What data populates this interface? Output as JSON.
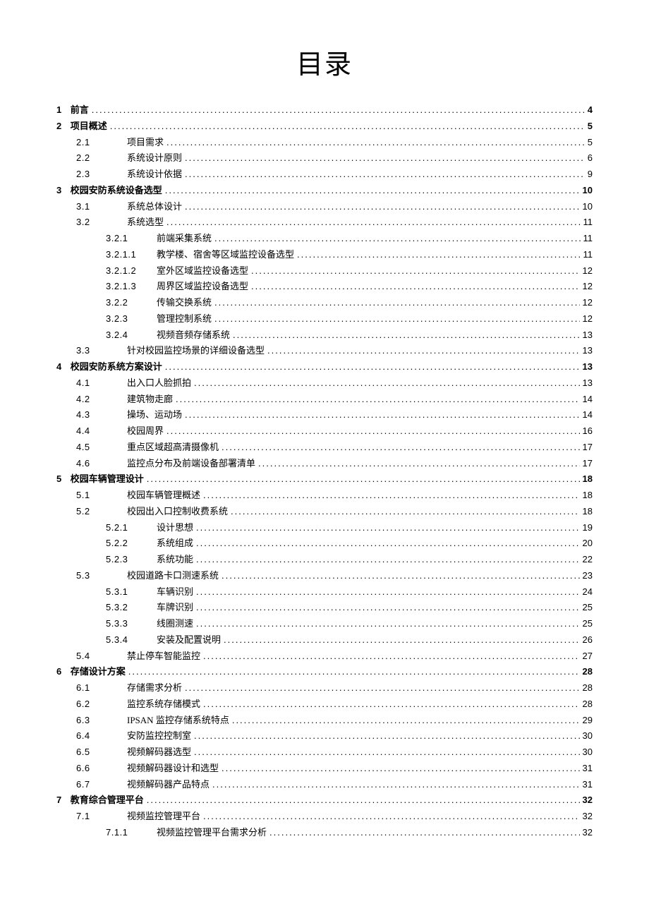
{
  "title": "目录",
  "entries": [
    {
      "level": 1,
      "bold": true,
      "num": "1",
      "label": "前言",
      "page": "4"
    },
    {
      "level": 1,
      "bold": true,
      "num": "2",
      "label": "项目概述",
      "page": "5"
    },
    {
      "level": 2,
      "num": "2.1",
      "label": "项目需求",
      "page": "5"
    },
    {
      "level": 2,
      "num": "2.2",
      "label": "系统设计原则",
      "page": "6"
    },
    {
      "level": 2,
      "num": "2.3",
      "label": "系统设计依据",
      "page": "9"
    },
    {
      "level": 1,
      "bold": true,
      "num": "3",
      "label": "校园安防系统设备选型",
      "page": "10"
    },
    {
      "level": 2,
      "num": "3.1",
      "label": "系统总体设计",
      "page": "10"
    },
    {
      "level": 2,
      "num": "3.2",
      "label": "系统选型",
      "page": "11"
    },
    {
      "level": 3,
      "num": "3.2.1",
      "label": "前端采集系统",
      "page": "11"
    },
    {
      "level": 4,
      "num": "3.2.1.1",
      "label": "教学楼、宿舍等区域监控设备选型",
      "page": "11"
    },
    {
      "level": 4,
      "num": "3.2.1.2",
      "label": "室外区域监控设备选型",
      "page": "12"
    },
    {
      "level": 4,
      "num": "3.2.1.3",
      "label": "周界区域监控设备选型",
      "page": "12"
    },
    {
      "level": 3,
      "num": "3.2.2",
      "label": "传输交换系统",
      "page": "12"
    },
    {
      "level": 3,
      "num": "3.2.3",
      "label": "管理控制系统",
      "page": "12"
    },
    {
      "level": 3,
      "num": "3.2.4",
      "label": "视频音频存储系统",
      "page": "13"
    },
    {
      "level": 2,
      "num": "3.3",
      "label": "针对校园监控场景的详细设备选型",
      "page": "13"
    },
    {
      "level": 1,
      "bold": true,
      "num": "4",
      "label": "校园安防系统方案设计",
      "page": "13"
    },
    {
      "level": 2,
      "num": "4.1",
      "label": "出入口人脸抓拍",
      "page": "13"
    },
    {
      "level": 2,
      "num": "4.2",
      "label": "建筑物走廊",
      "page": "14"
    },
    {
      "level": 2,
      "num": "4.3",
      "label": "操场、运动场",
      "page": "14"
    },
    {
      "level": 2,
      "num": "4.4",
      "label": "校园周界",
      "page": "16"
    },
    {
      "level": 2,
      "num": "4.5",
      "label": "重点区域超高清摄像机",
      "page": "17"
    },
    {
      "level": 2,
      "num": "4.6",
      "label": "监控点分布及前端设备部署清单",
      "page": "17"
    },
    {
      "level": 1,
      "bold": true,
      "num": "5",
      "label": "校园车辆管理设计",
      "page": "18"
    },
    {
      "level": 2,
      "num": "5.1",
      "label": "校园车辆管理概述",
      "page": "18"
    },
    {
      "level": 2,
      "num": "5.2",
      "label": "校园出入口控制收费系统",
      "page": "18"
    },
    {
      "level": 3,
      "num": "5.2.1",
      "label": "设计思想",
      "page": "19"
    },
    {
      "level": 3,
      "num": "5.2.2",
      "label": "系统组成",
      "page": "20"
    },
    {
      "level": 3,
      "num": "5.2.3",
      "label": "系统功能",
      "page": "22"
    },
    {
      "level": 2,
      "num": "5.3",
      "label": "校园道路卡口测速系统",
      "page": "23"
    },
    {
      "level": 3,
      "num": "5.3.1",
      "label": "车辆识别",
      "page": "24"
    },
    {
      "level": 3,
      "num": "5.3.2",
      "label": "车牌识别",
      "page": "25"
    },
    {
      "level": 3,
      "num": "5.3.3",
      "label": "线圈测速",
      "page": "25"
    },
    {
      "level": 3,
      "num": "5.3.4",
      "label": "安装及配置说明",
      "page": "26"
    },
    {
      "level": 2,
      "num": "5.4",
      "label": "禁止停车智能监控",
      "page": "27"
    },
    {
      "level": 1,
      "bold": true,
      "num": "6",
      "label": "存储设计方案",
      "page": "28"
    },
    {
      "level": 2,
      "num": "6.1",
      "label": "存储需求分析",
      "page": "28"
    },
    {
      "level": 2,
      "num": "6.2",
      "label": "监控系统存储模式",
      "page": "28"
    },
    {
      "level": 2,
      "num": "6.3",
      "label": "IPSAN 监控存储系统特点",
      "page": "29"
    },
    {
      "level": 2,
      "num": "6.4",
      "label": "安防监控控制室",
      "page": "30"
    },
    {
      "level": 2,
      "num": "6.5",
      "label": "视频解码器选型",
      "page": "30"
    },
    {
      "level": 2,
      "num": "6.6",
      "label": "视频解码器设计和选型",
      "page": "31"
    },
    {
      "level": 2,
      "num": "6.7",
      "label": "视频解码器产品特点",
      "page": "31"
    },
    {
      "level": 1,
      "bold": true,
      "num": "7",
      "label": "教育综合管理平台",
      "page": "32"
    },
    {
      "level": 2,
      "num": "7.1",
      "label": "视频监控管理平台",
      "page": "32"
    },
    {
      "level": 3,
      "num": "7.1.1",
      "label": "视频监控管理平台需求分析",
      "page": "32"
    }
  ]
}
